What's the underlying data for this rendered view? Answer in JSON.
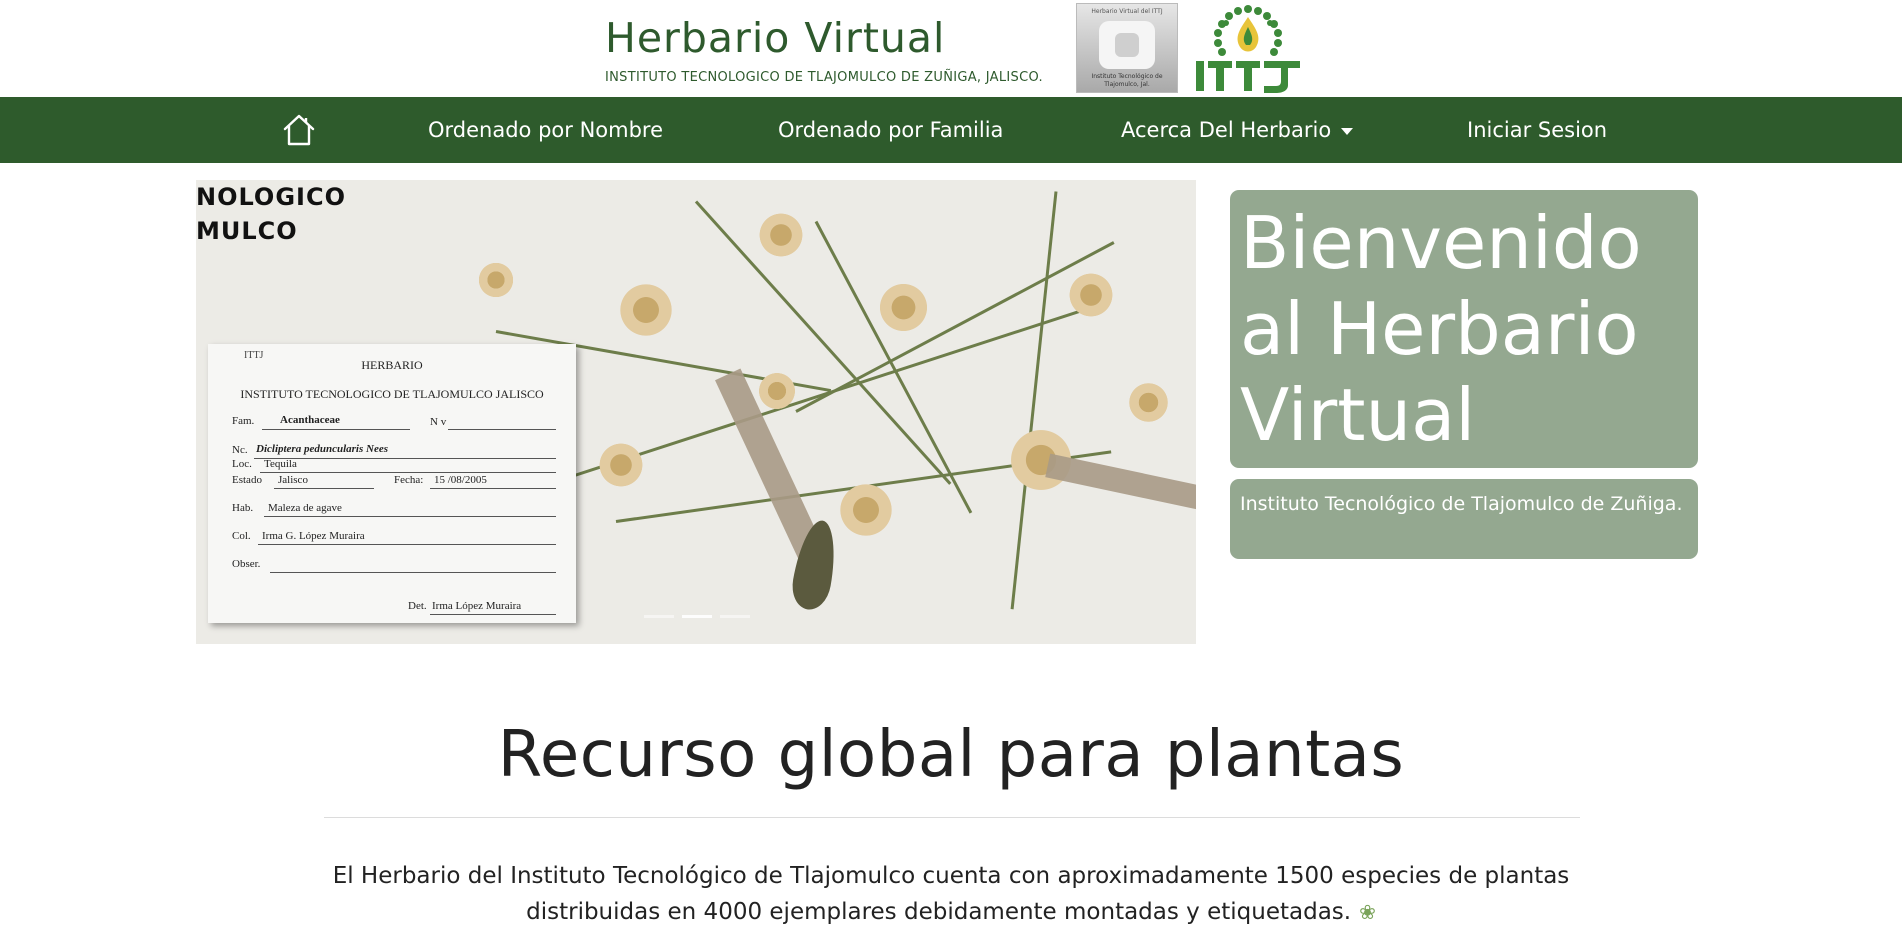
{
  "header": {
    "title": "Herbario Virtual",
    "subtitle": "INSTITUTO TECNOLOGICO DE TLAJOMULCO DE ZUÑIGA, JALISCO.",
    "logo_box": {
      "top_text": "Herbario Virtual del ITTJ",
      "bottom_text": "Instituto Tecnológico de Tlajomulco, Jal."
    },
    "logo_itt_text": "ITTJ"
  },
  "nav": {
    "home_icon": "home-icon",
    "items": [
      {
        "label": "Ordenado por Nombre"
      },
      {
        "label": "Ordenado por Familia"
      },
      {
        "label": "Acerca Del Herbario"
      },
      {
        "label": "Iniciar Sesion"
      }
    ]
  },
  "hero": {
    "corner_text_1": "NOLOGICO",
    "corner_text_2": "MULCO",
    "label": {
      "heading": "HERBARIO",
      "institute": "INSTITUTO TECNOLOGICO DE TLAJOMULCO JALISCO",
      "fam_label": "Fam.",
      "fam_value": "Acanthaceae",
      "nv_label": "N v",
      "nc_label": "Nc.",
      "nc_value": "Dicliptera peduncularis Nees",
      "loc_label": "Loc.",
      "loc_value": "Tequila",
      "estado_label": "Estado",
      "estado_value": "Jalisco",
      "fecha_label": "Fecha:",
      "fecha_value": "15 /08/2005",
      "hab_label": "Hab.",
      "hab_value": "Maleza de agave",
      "col_label": "Col.",
      "col_value": "Irma G. López Muraira",
      "obser_label": "Obser.",
      "det_label": "Det.",
      "det_value": "Irma López Muraira"
    }
  },
  "welcome": {
    "title": "Bienvenido al Herbario Virtual",
    "institute": "Instituto Tecnológico de Tlajomulco de Zuñiga."
  },
  "section": {
    "title": "Recurso global para plantas",
    "description": "El Herbario del Instituto Tecnológico de Tlajomulco cuenta con aproximadamente 1500 especies de plantas distribuidas en 4000 ejemplares debidamente montadas y etiquetadas.",
    "leaf_icon": "leaf-icon"
  },
  "colors": {
    "nav_bg": "#2e5b2c",
    "brand_green": "#2e5a2d",
    "card_bg": "#94a890"
  }
}
